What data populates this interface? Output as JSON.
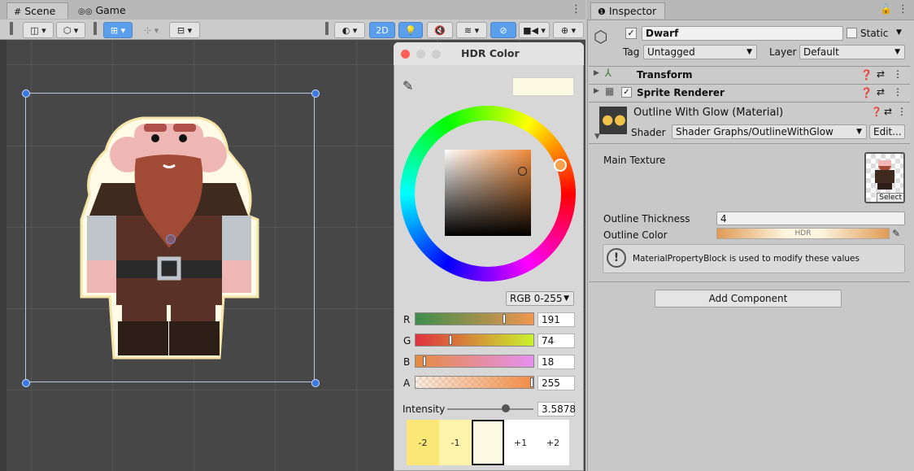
{
  "scene_tabs": {
    "scene": "Scene",
    "game": "Game"
  },
  "scene_toolbar": {
    "mode_2d": "2D"
  },
  "color_picker": {
    "title": "HDR Color",
    "mode": "RGB 0-255",
    "channels": [
      {
        "label": "R",
        "value": "191"
      },
      {
        "label": "G",
        "value": "74"
      },
      {
        "label": "B",
        "value": "18"
      },
      {
        "label": "A",
        "value": "255"
      }
    ],
    "intensity_label": "Intensity",
    "intensity_value": "3.5878",
    "intensity_fraction": 0.78,
    "swatches": [
      "-2",
      "-1",
      "",
      "+1",
      "+2"
    ],
    "colors": {
      "preview": "#fdfbe4",
      "swatch_m2": "#fbe776",
      "swatch_m1": "#fdf3aa",
      "swatch_0": "#fdfbe4"
    }
  },
  "inspector": {
    "tab": "Inspector",
    "object_name": "Dwarf",
    "static_label": "Static",
    "tag_label": "Tag",
    "tag_value": "Untagged",
    "layer_label": "Layer",
    "layer_value": "Default",
    "components": {
      "transform": "Transform",
      "sprite_renderer": "Sprite Renderer"
    },
    "material": {
      "title": "Outline With Glow (Material)",
      "shader_label": "Shader",
      "shader_value": "Shader Graphs/OutlineWithGlow",
      "edit_button": "Edit..."
    },
    "properties": {
      "main_texture": "Main Texture",
      "select_label": "Select",
      "outline_thickness": "Outline Thickness",
      "outline_thickness_value": "4",
      "outline_color": "Outline Color",
      "outline_color_badge": "HDR"
    },
    "info_message": "MaterialPropertyBlock is used to modify these values",
    "add_component": "Add Component"
  }
}
